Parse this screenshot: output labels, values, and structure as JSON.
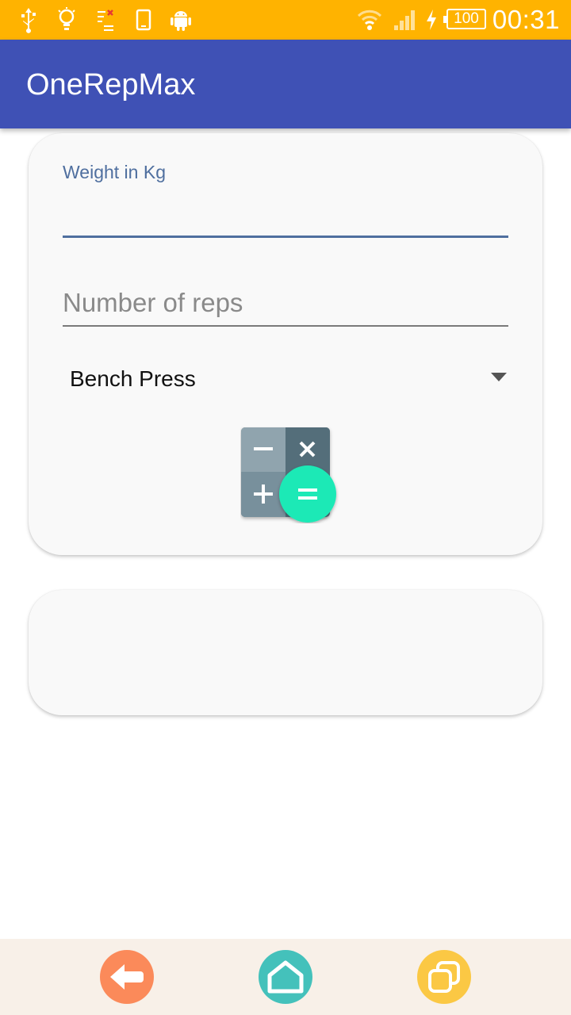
{
  "status_bar": {
    "time": "00:31",
    "battery": "100",
    "icons": [
      "usb-icon",
      "lightbulb-icon",
      "notification-list-icon",
      "phone-icon",
      "android-icon",
      "wifi-icon",
      "signal-icon",
      "charging-icon",
      "battery-icon"
    ],
    "background": "#ffb300"
  },
  "app_bar": {
    "title": "OneRepMax",
    "background": "#3f51b5"
  },
  "form": {
    "weight_label": "Weight in Kg",
    "weight_value": "",
    "reps_placeholder": "Number of reps",
    "exercise_selected": "Bench Press",
    "calculate_icon": "calculator-icon"
  },
  "result_card": {
    "text": ""
  },
  "nav_bar": {
    "buttons": [
      "back-icon",
      "home-icon",
      "recent-apps-icon"
    ],
    "colors": {
      "back": "#fb8a5a",
      "home": "#44c1bb",
      "recent": "#fbc844"
    }
  }
}
